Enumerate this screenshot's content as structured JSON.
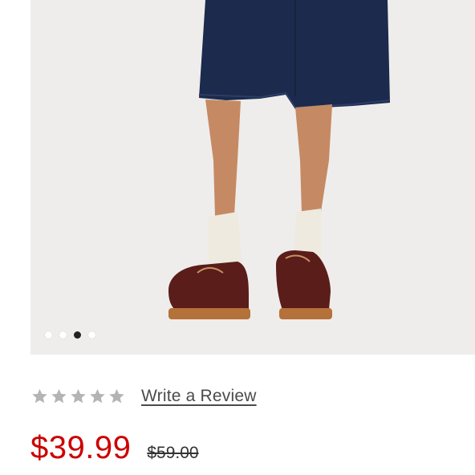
{
  "gallery": {
    "image_description_icon": "product-photo-icon",
    "dots": [
      {
        "active": false
      },
      {
        "active": false
      },
      {
        "active": true
      },
      {
        "active": false
      }
    ]
  },
  "rating": {
    "stars_filled": 0,
    "stars_total": 5,
    "star_color": "#b4b4b4",
    "write_review_label": "Write a Review"
  },
  "price": {
    "sale": "$39.99",
    "original": "$59.00",
    "sale_color": "#cc0000"
  }
}
